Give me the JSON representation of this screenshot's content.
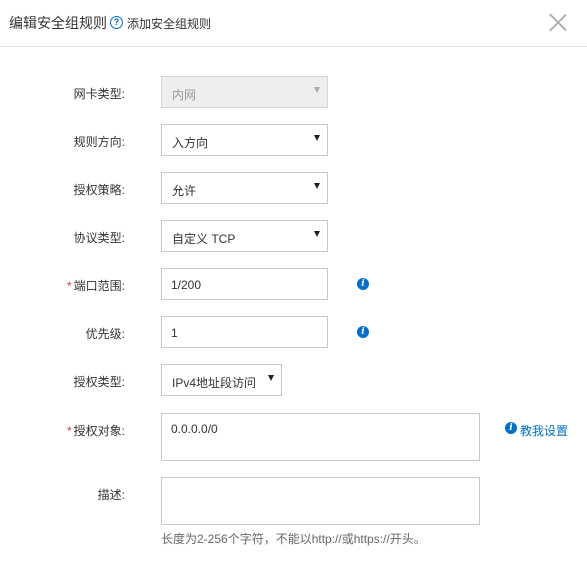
{
  "dialog": {
    "title": "编辑安全组规则",
    "help_icon": "question-icon",
    "help_link": "添加安全组规则",
    "close_icon": "close-icon"
  },
  "form": {
    "nic_type": {
      "label": "网卡类型:",
      "value": "内网",
      "disabled": true
    },
    "direction": {
      "label": "规则方向:",
      "value": "入方向"
    },
    "policy": {
      "label": "授权策略:",
      "value": "允许"
    },
    "protocol": {
      "label": "协议类型:",
      "value": "自定义 TCP"
    },
    "port_range": {
      "required": "*",
      "label": "端口范围:",
      "value": "1/200",
      "info_icon": "info-icon"
    },
    "priority": {
      "label": "优先级:",
      "value": "1",
      "info_icon": "info-icon"
    },
    "auth_type": {
      "label": "授权类型:",
      "value": "IPv4地址段访问"
    },
    "auth_object": {
      "required": "*",
      "label": "授权对象:",
      "value": "0.0.0.0/0",
      "teach_link": "教我设置"
    },
    "description": {
      "label": "描述:",
      "value": "",
      "hint": "长度为2-256个字符，不能以http://或https://开头。"
    }
  },
  "colors": {
    "accent": "#0070cc",
    "required": "#e0303a",
    "border": "#c8c8c8",
    "disabled_bg": "#eeeeee"
  }
}
